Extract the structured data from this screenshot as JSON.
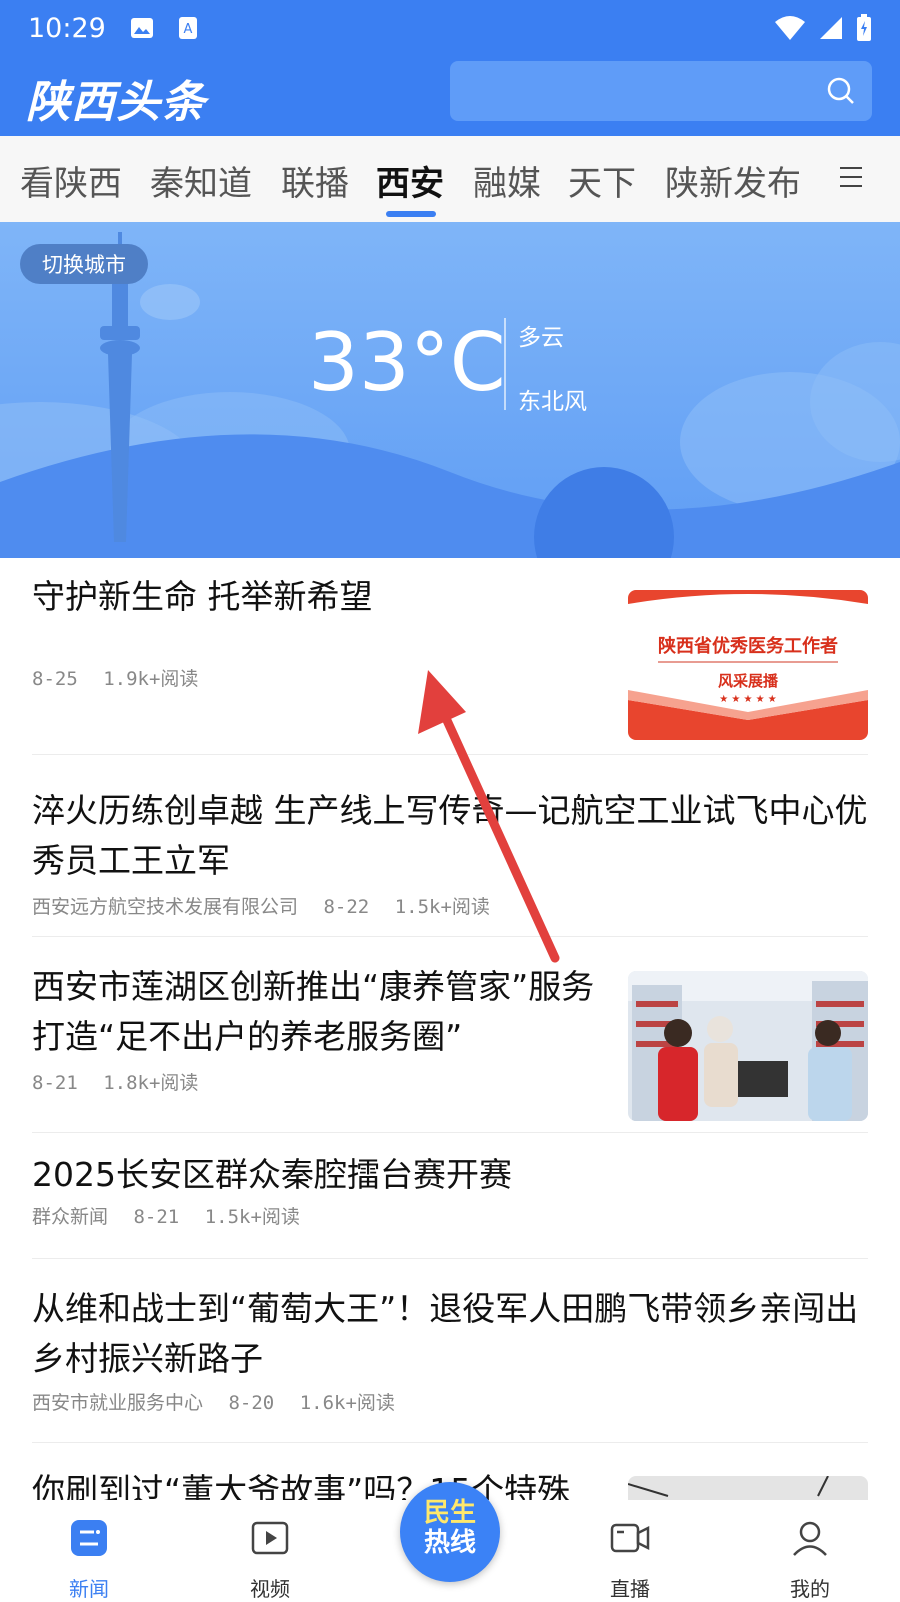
{
  "status": {
    "time": "10:29"
  },
  "header": {
    "logo": "陕西头条",
    "search_placeholder": ""
  },
  "tabs": [
    {
      "label": "看陕西"
    },
    {
      "label": "秦知道"
    },
    {
      "label": "联播"
    },
    {
      "label": "西安",
      "active": true
    },
    {
      "label": "融媒"
    },
    {
      "label": "天下"
    },
    {
      "label": "陕新发布"
    }
  ],
  "weather": {
    "switch_city": "切换城市",
    "temperature": "33°C",
    "condition": "多云",
    "wind": "东北风"
  },
  "news": [
    {
      "title": "守护新生命  托举新希望",
      "date": "8-25",
      "reads": "1.9k+阅读",
      "thumb": {
        "line1": "陕西省优秀医务工作者",
        "line2": "风采展播",
        "stars": "★ ★ ★ ★ ★"
      }
    },
    {
      "title": "淬火历练创卓越  生产线上写传奇—记航空工业试飞中心优秀员工王立军",
      "source": "西安远方航空技术发展有限公司",
      "date": "8-22",
      "reads": "1.5k+阅读"
    },
    {
      "title": "西安市莲湖区创新推出“康养管家”服务  打造“足不出户的养老服务圈”",
      "date": "8-21",
      "reads": "1.8k+阅读"
    },
    {
      "title": "2025长安区群众秦腔擂台赛开赛",
      "source": "群众新闻",
      "date": "8-21",
      "reads": "1.5k+阅读"
    },
    {
      "title": "从维和战士到“葡萄大王”！退役军人田鹏飞带领乡亲闯出乡村振兴新路子",
      "source": "西安市就业服务中心",
      "date": "8-20",
      "reads": "1.6k+阅读"
    },
    {
      "title": "你刷到过“董大爷故事”吗？15个特殊"
    }
  ],
  "bottom_nav": {
    "news": "新闻",
    "video": "视频",
    "hotline_line1": "民生",
    "hotline_line2": "热线",
    "live": "直播",
    "mine": "我的"
  },
  "colors": {
    "brand_blue": "#3b7ff2",
    "arrow_red": "#e2403d"
  }
}
